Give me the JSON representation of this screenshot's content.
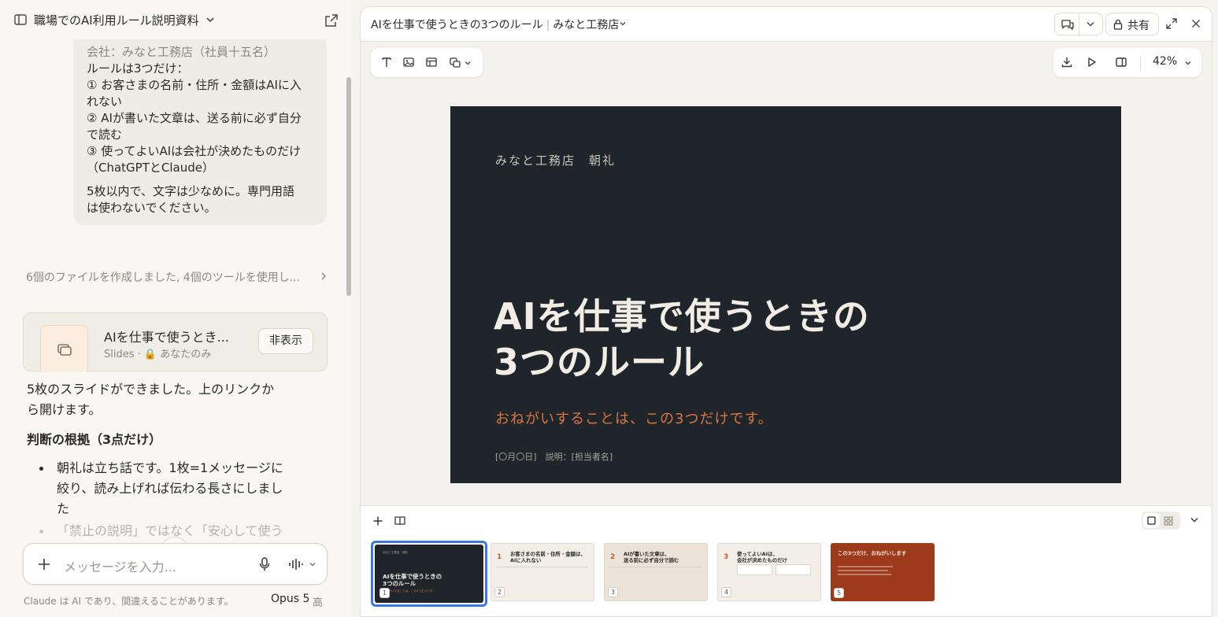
{
  "left_panel": {
    "conversation_title": "職場でのAI利用ルール説明資料",
    "user_message": {
      "lines": [
        "会社：みなと工務店（社員十五名）",
        "ルールは3つだけ：",
        "① お客さまの名前・住所・金額はAIに入",
        "れない",
        "② AIが書いた文章は、送る前に必ず自分",
        "で読む",
        "③ 使ってよいAIは会社が決めたものだけ",
        "（ChatGPTとClaude）"
      ],
      "closing_lines": [
        "5枚以内で、文字は少なめに。専門用語",
        "は使わないでください。"
      ]
    },
    "tool_summary": "6個のファイルを作成しました, 4個のツールを使用し...",
    "artifact": {
      "title": "AIを仕事で使うとき...",
      "subtitle": "Slides · 🔒 あなたのみ",
      "hide_label": "非表示"
    },
    "response_lines": [
      "5枚のスライドができました。上のリンクか",
      "ら開けます。"
    ],
    "response_heading": "判断の根拠（3点だけ）",
    "bullets": [
      [
        "朝礼は立ち話です。1枚=1メッセージに",
        "絞り、読み上げれば伝わる長さにしまし",
        "た"
      ],
      [
        "「禁止の説明」ではなく「安心して使う"
      ]
    ],
    "composer_placeholder": "メッセージを入力...",
    "footer_note": "Claude は AI であり、間違えることがあります。",
    "model_name": "Opus 5",
    "model_level": "高"
  },
  "right_panel": {
    "title": "AIを仕事で使うときの3つのルール",
    "workspace": "みなと工務店",
    "share_label": "共有",
    "zoom": "42%",
    "slide": {
      "kicker": "みなと工務店　朝礼",
      "title_line1": "AIを仕事で使うときの",
      "title_line2": "3つのルール",
      "subtitle": "おねがいすることは、この3つだけです。",
      "meta": "[〇月〇日]　説明：[担当者名]"
    },
    "thumbnails": [
      {
        "num": "1",
        "kicker": "みなと工務店　朝礼",
        "title": "AIを仕事で使うときの\n3つのルール",
        "subtitle": "おねがいすることは、この3つだけです。",
        "bg": "#1f252b",
        "selected": true
      },
      {
        "num": "2",
        "index": "1",
        "title": "お客さまの名前・住所・金額は、\nAIに入れない",
        "bg": "#f3efe8"
      },
      {
        "num": "3",
        "index": "2",
        "title": "AIが書いた文章は、\n送る前に必ず自分で読む",
        "bg": "#ece3d8"
      },
      {
        "num": "4",
        "index": "3",
        "title": "使ってよいAIは、\n会社が決めたものだけ",
        "bg": "#f3efe8"
      },
      {
        "num": "5",
        "title": "この3つだけ、おねがいします",
        "bg": "#9e3a1c"
      }
    ],
    "colors": {
      "slide_bg": "#1f252b",
      "accent_orange": "#d9763f",
      "selection_blue": "#3b78e7",
      "closing_red": "#9e3a1c"
    }
  }
}
